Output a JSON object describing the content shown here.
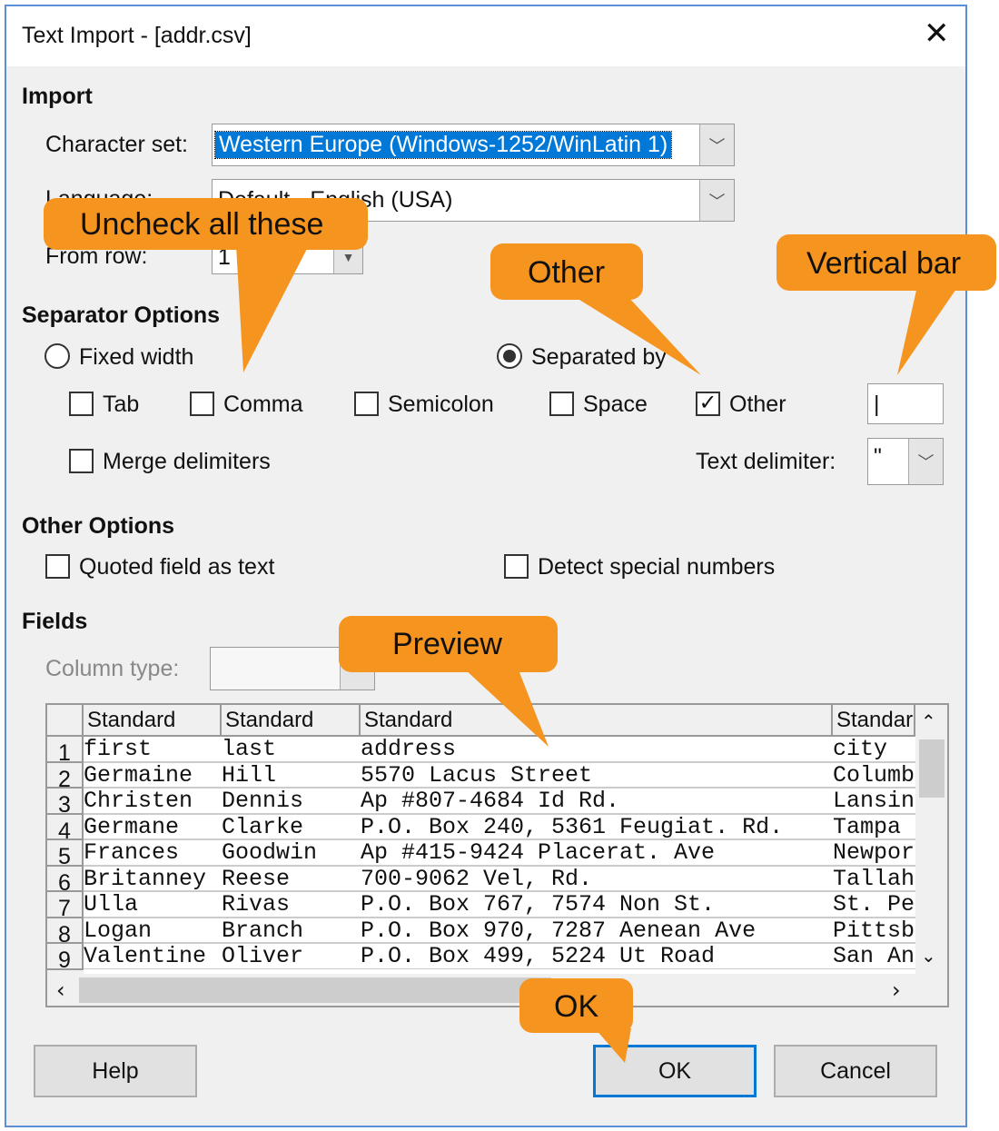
{
  "window": {
    "title": "Text Import - [addr.csv]"
  },
  "import": {
    "heading": "Import",
    "charset_label": "Character set:",
    "charset_value": "Western Europe (Windows-1252/WinLatin 1)",
    "language_label": "Language:",
    "language_value": "Default - English (USA)",
    "from_row_label": "From row:",
    "from_row_value": "1"
  },
  "separator": {
    "heading": "Separator Options",
    "fixed_width": "Fixed width",
    "separated_by": "Separated by",
    "tab": "Tab",
    "comma": "Comma",
    "semicolon": "Semicolon",
    "space": "Space",
    "other": "Other",
    "other_value": "|",
    "merge": "Merge delimiters",
    "text_delim_label": "Text delimiter:",
    "text_delim_value": "\"",
    "state": {
      "separated_by": true,
      "tab": false,
      "comma": false,
      "semicolon": false,
      "space": false,
      "other": true,
      "merge": false
    }
  },
  "other_options": {
    "heading": "Other Options",
    "quoted": "Quoted field as text",
    "detect": "Detect special numbers"
  },
  "fields": {
    "heading": "Fields",
    "column_type_label": "Column type:",
    "column_type_value": ""
  },
  "preview": {
    "headers": [
      "Standard",
      "Standard",
      "Standard",
      "Standard"
    ],
    "rows": [
      [
        "1",
        "first",
        "last",
        "address",
        "city"
      ],
      [
        "2",
        "Germaine",
        "Hill",
        "5570 Lacus Street",
        "Columb"
      ],
      [
        "3",
        "Christen",
        "Dennis",
        "Ap #807-4684 Id Rd.",
        "Lansin"
      ],
      [
        "4",
        "Germane",
        "Clarke",
        "P.O. Box 240, 5361 Feugiat. Rd.",
        "Tampa"
      ],
      [
        "5",
        "Frances",
        "Goodwin",
        "Ap #415-9424 Placerat. Ave",
        "Newpor"
      ],
      [
        "6",
        "Britanney",
        "Reese",
        "700-9062 Vel, Rd.",
        "Tallah"
      ],
      [
        "7",
        "Ulla",
        "Rivas",
        "P.O. Box 767, 7574 Non St.",
        "St. Pe"
      ],
      [
        "8",
        "Logan",
        "Branch",
        "P.O. Box 970, 7287 Aenean Ave",
        "Pittsb"
      ],
      [
        "9",
        "Valentine",
        "Oliver",
        "P.O. Box 499, 5224 Ut Road",
        "San An"
      ]
    ]
  },
  "buttons": {
    "help": "Help",
    "ok": "OK",
    "cancel": "Cancel"
  },
  "callouts": {
    "uncheck": "Uncheck all these",
    "other": "Other",
    "vertical_bar": "Vertical bar",
    "preview": "Preview",
    "ok": "OK",
    "color": "#f5941f"
  }
}
